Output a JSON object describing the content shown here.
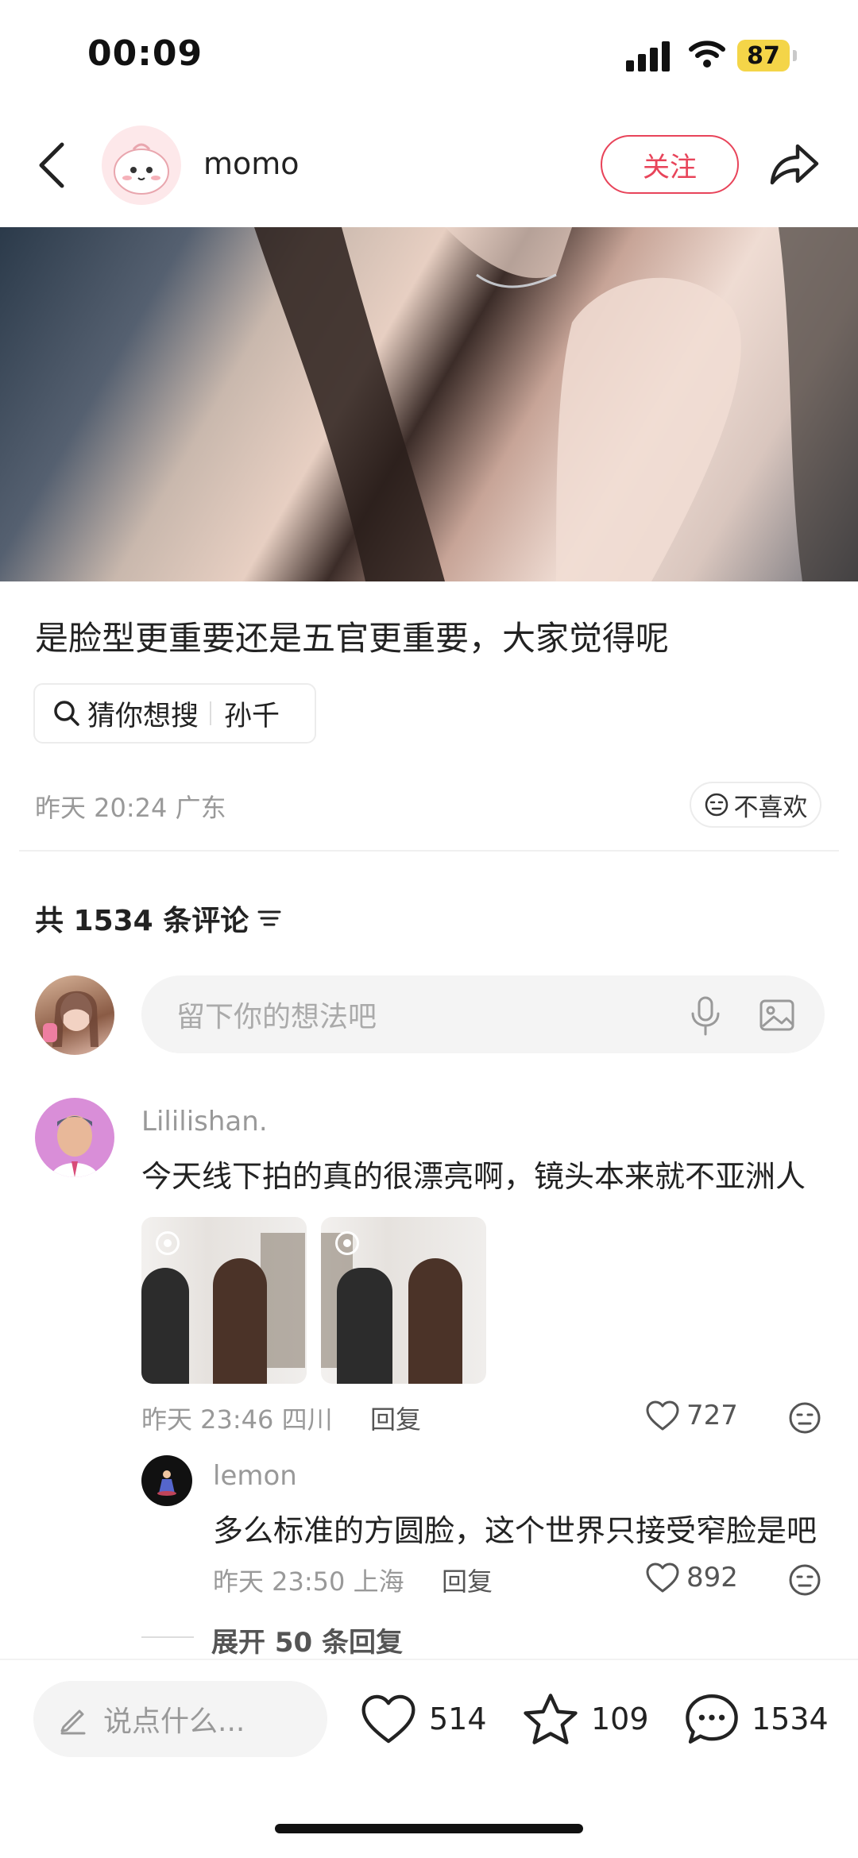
{
  "status_bar": {
    "time": "00:09",
    "battery": "87"
  },
  "header": {
    "author_name": "momo",
    "follow_label": "关注"
  },
  "post": {
    "title": "是脸型更重要还是五官更重要，大家觉得呢",
    "search_chip": {
      "label": "猜你想搜",
      "term": "孙千"
    },
    "meta": "昨天 20:24 广东",
    "dislike_label": "不喜欢"
  },
  "comments_header": {
    "count_text": "共 1534 条评论"
  },
  "comment_input": {
    "placeholder": "留下你的想法吧"
  },
  "comments": [
    {
      "name": "Lililishan.",
      "text": "今天线下拍的真的很漂亮啊，镜头本来就不亚洲人",
      "meta": "昨天 23:46 四川",
      "reply_label": "回复",
      "likes": "727",
      "replies": [
        {
          "name": "lemon",
          "text": "多么标准的方圆脸，这个世界只接受窄脸是吧",
          "meta": "昨天 23:50 上海",
          "reply_label": "回复",
          "likes": "892"
        }
      ],
      "expand_label": "展开 50 条回复"
    }
  ],
  "bottom_bar": {
    "say_placeholder": "说点什么...",
    "likes": "514",
    "favorites": "109",
    "comments": "1534"
  },
  "colors": {
    "accent": "#e8445a",
    "muted": "#999999",
    "input_bg": "#f4f4f4"
  }
}
